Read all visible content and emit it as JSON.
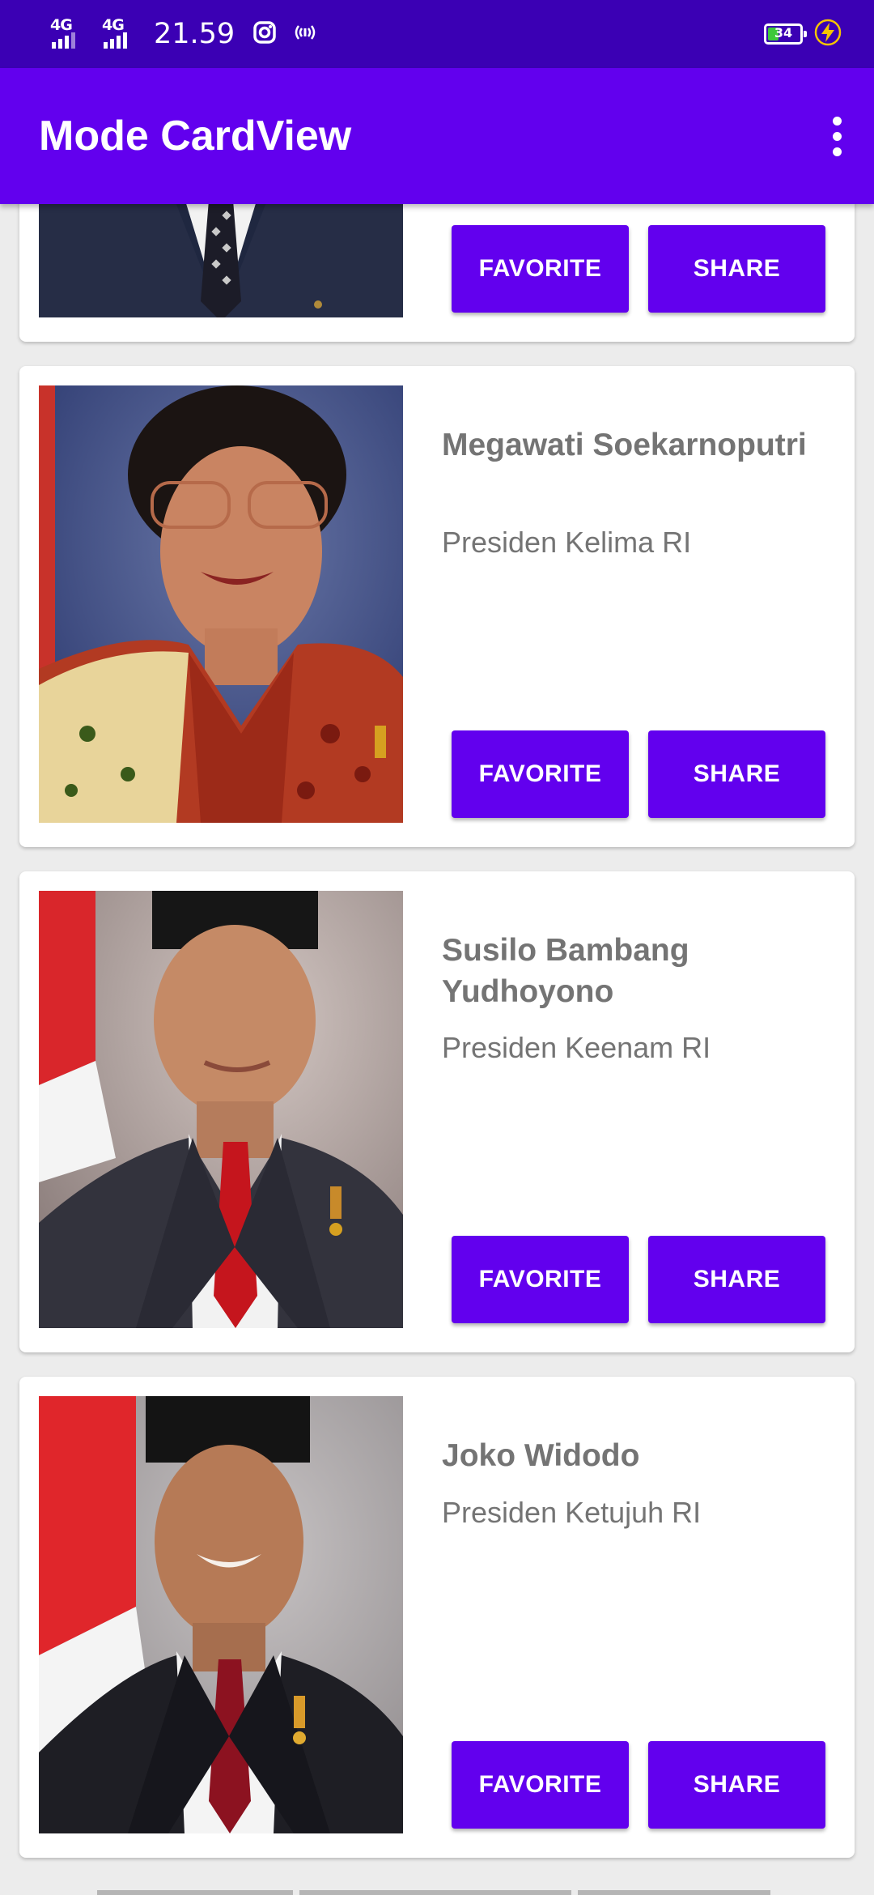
{
  "status_bar": {
    "signal_1": "4G",
    "signal_2": "4G",
    "time": "21.59",
    "battery_level": 34,
    "battery_level_text": "34",
    "icons": [
      "signal-icon",
      "signal-icon",
      "instagram-icon",
      "hotspot-icon",
      "battery-icon",
      "charging-icon"
    ]
  },
  "app_bar": {
    "title": "Mode CardView",
    "menu_icon": "more-vert-icon"
  },
  "presidents": [
    {
      "name": "",
      "description": "",
      "favorite_label": "FAVORITE",
      "share_label": "SHARE"
    },
    {
      "name": "Megawati Soekarnoputri",
      "description": "Presiden Kelima RI",
      "favorite_label": "FAVORITE",
      "share_label": "SHARE"
    },
    {
      "name": "Susilo Bambang Yudhoyono",
      "description": "Presiden Keenam RI",
      "favorite_label": "FAVORITE",
      "share_label": "SHARE"
    },
    {
      "name": "Joko Widodo",
      "description": "Presiden Ketujuh RI",
      "favorite_label": "FAVORITE",
      "share_label": "SHARE"
    }
  ],
  "colors": {
    "status_bar": "#3b00b4",
    "app_bar": "#6200ee",
    "button": "#6200ee",
    "text_secondary": "#747474",
    "background": "#ececec"
  }
}
